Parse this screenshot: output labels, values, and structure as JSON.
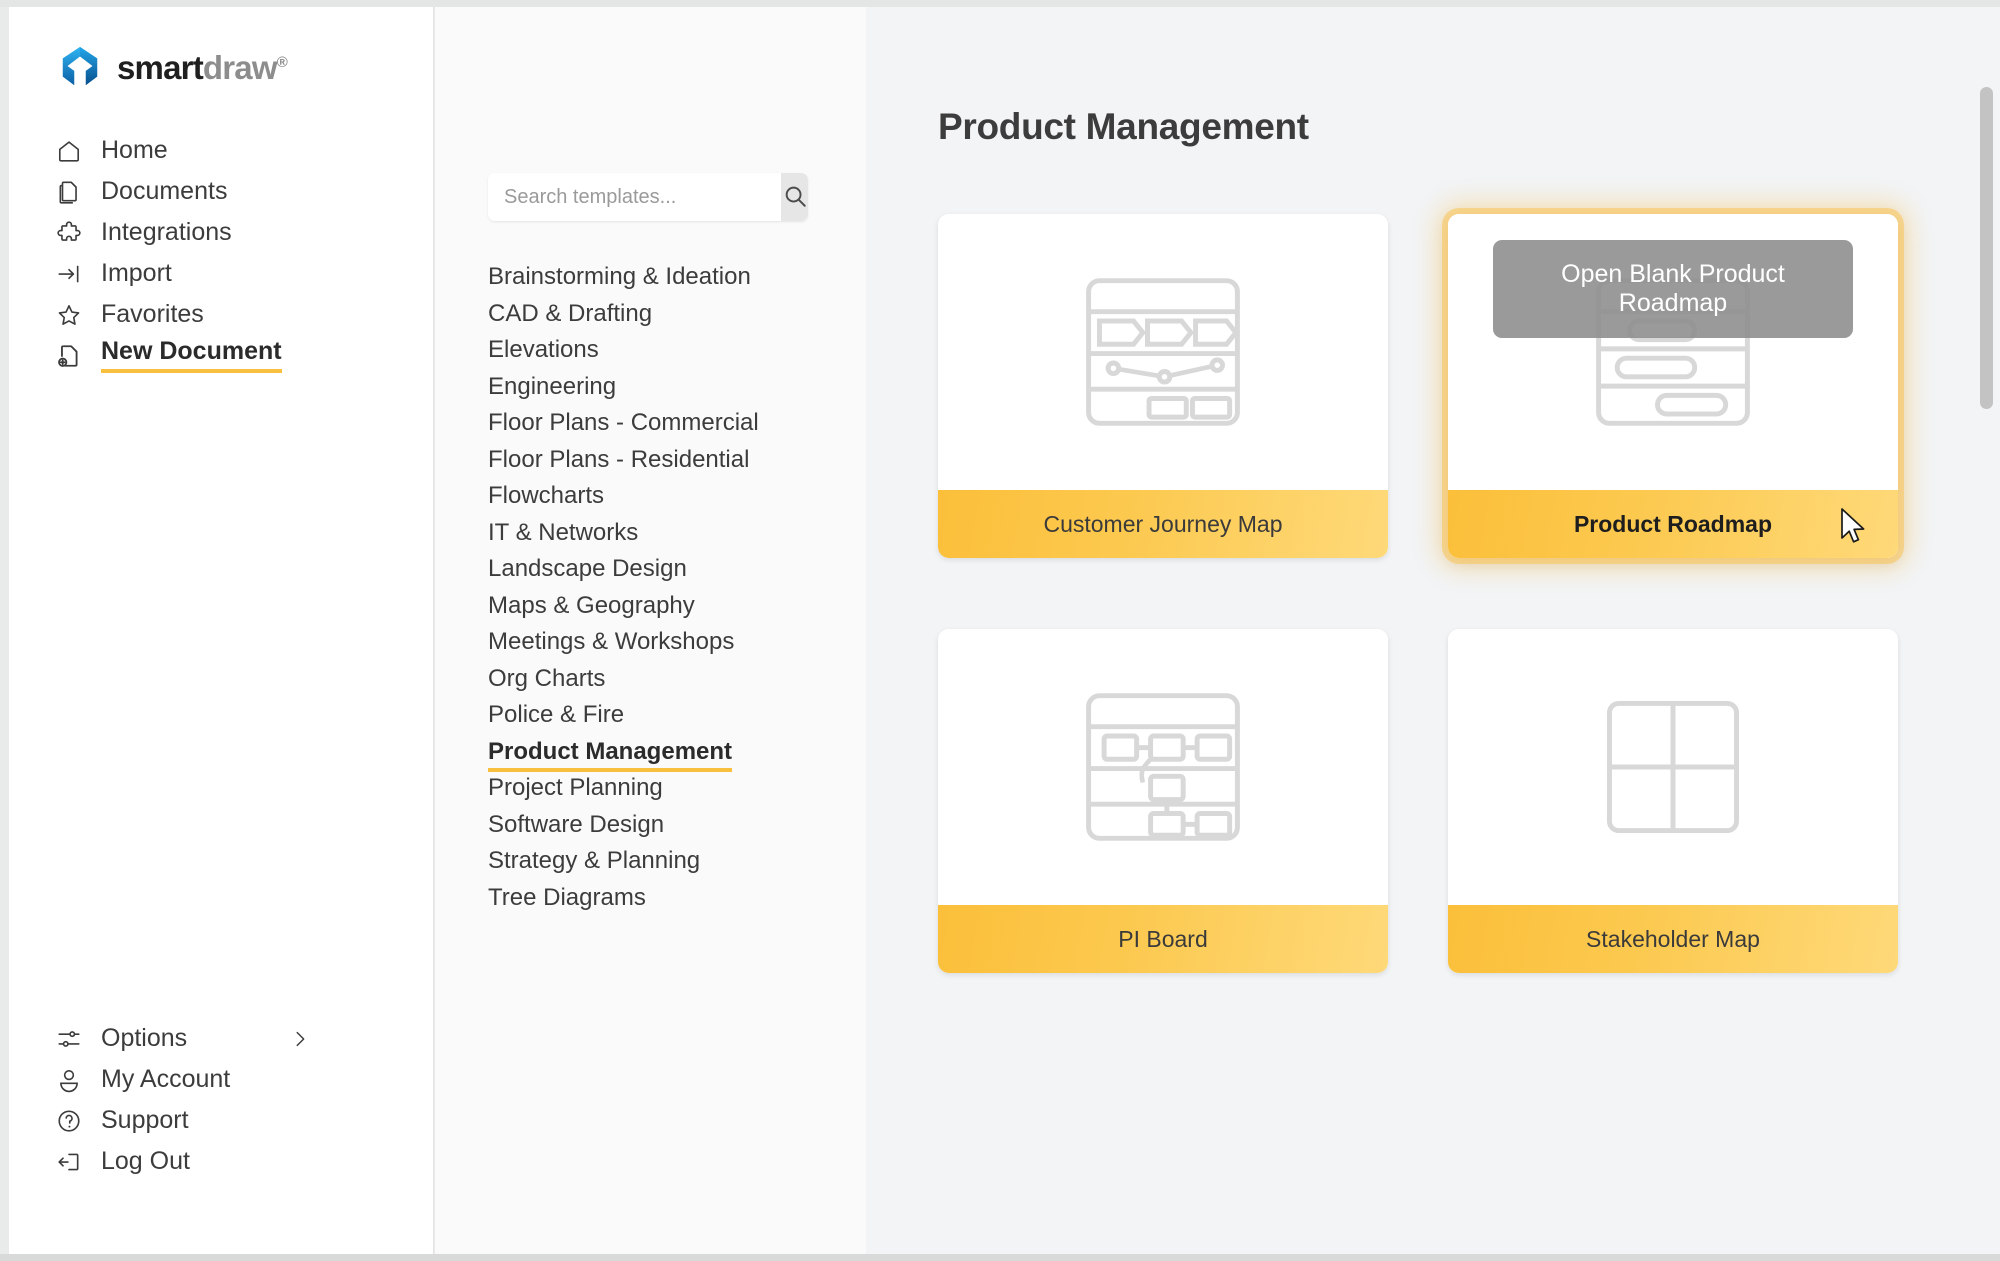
{
  "app": {
    "brand_smart": "smart",
    "brand_draw": "draw",
    "brand_tm": "®"
  },
  "sidebar": {
    "top_items": [
      {
        "label": "Home",
        "icon": "home-icon"
      },
      {
        "label": "Documents",
        "icon": "documents-icon"
      },
      {
        "label": "Integrations",
        "icon": "puzzle-icon"
      },
      {
        "label": "Import",
        "icon": "import-arrow-icon"
      },
      {
        "label": "Favorites",
        "icon": "star-icon"
      },
      {
        "label": "New Document",
        "icon": "new-document-icon",
        "active": true
      }
    ],
    "bottom_items": [
      {
        "label": "Options",
        "icon": "sliders-icon",
        "chevron": "chevron-right-icon"
      },
      {
        "label": "My Account",
        "icon": "user-icon"
      },
      {
        "label": "Support",
        "icon": "question-circle-icon"
      },
      {
        "label": "Log Out",
        "icon": "logout-icon"
      }
    ]
  },
  "search": {
    "placeholder": "Search templates...",
    "value": "",
    "button_icon": "search-icon"
  },
  "categories": [
    {
      "label": "Brainstorming & Ideation"
    },
    {
      "label": "CAD & Drafting"
    },
    {
      "label": "Elevations"
    },
    {
      "label": "Engineering"
    },
    {
      "label": "Floor Plans - Commercial"
    },
    {
      "label": "Floor Plans - Residential"
    },
    {
      "label": "Flowcharts"
    },
    {
      "label": "IT & Networks"
    },
    {
      "label": "Landscape Design"
    },
    {
      "label": "Maps & Geography"
    },
    {
      "label": "Meetings & Workshops"
    },
    {
      "label": "Org Charts"
    },
    {
      "label": "Police & Fire"
    },
    {
      "label": "Product Management",
      "active": true
    },
    {
      "label": "Project Planning"
    },
    {
      "label": "Software Design"
    },
    {
      "label": "Strategy & Planning"
    },
    {
      "label": "Tree Diagrams"
    }
  ],
  "main": {
    "title": "Product Management",
    "cards": [
      {
        "label": "Customer Journey Map",
        "thumb": "journey-map-thumb",
        "hovered": false
      },
      {
        "label": "Product Roadmap",
        "thumb": "roadmap-thumb",
        "hovered": true,
        "hover_button": "Open Blank Product Roadmap"
      },
      {
        "label": "PI Board",
        "thumb": "pi-board-thumb",
        "hovered": false
      },
      {
        "label": "Stakeholder Map",
        "thumb": "stakeholder-map-thumb",
        "hovered": false
      }
    ]
  },
  "colors": {
    "accent": "#f8c03e",
    "label_gradient_start": "#fbbf3a",
    "label_gradient_end": "#fed979",
    "thumb_line": "#d8d8d8",
    "hover_overlay": "#8c8c8c"
  }
}
